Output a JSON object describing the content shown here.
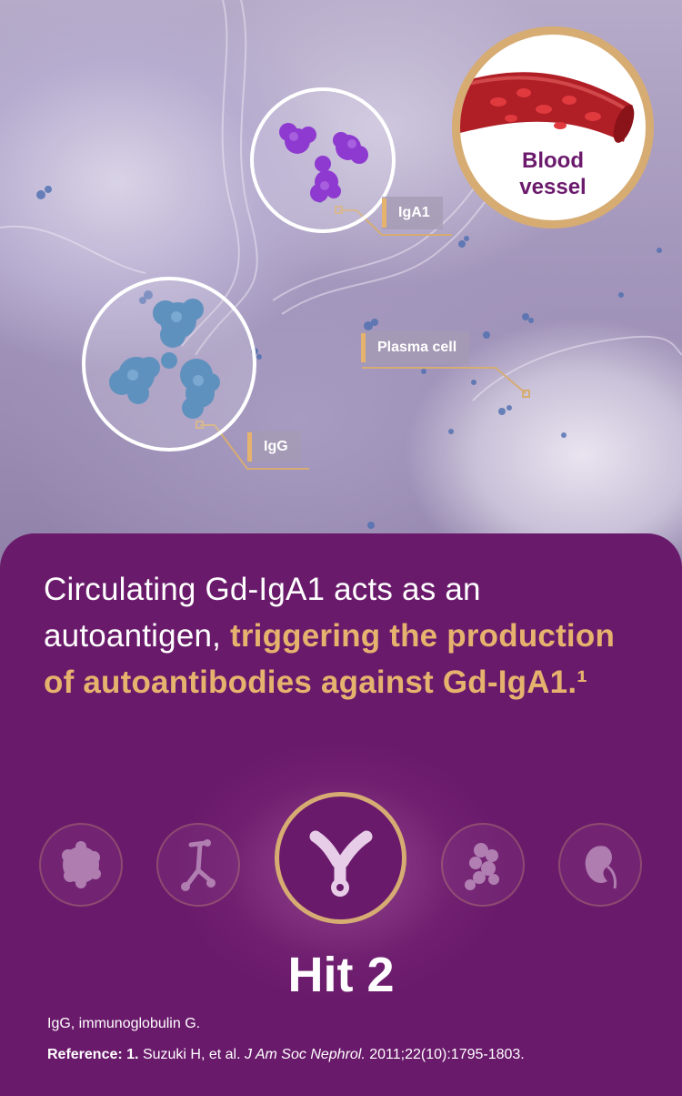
{
  "scene": {
    "blood_vessel_label_line1": "Blood",
    "blood_vessel_label_line2": "vessel",
    "iga1_label": "IgA1",
    "plasma_cell_label": "Plasma cell",
    "igg_label": "IgG"
  },
  "panel": {
    "headline_plain": "Circulating Gd-IgA1 acts as an autoantigen, ",
    "headline_highlight": "triggering the production of autoantibodies against Gd-IgA1.¹",
    "hit_label": "Hit 2",
    "abbreviation": "IgG, immunoglobulin G.",
    "reference": {
      "label": "Reference: 1.",
      "authors": " Suzuki H, et al. ",
      "journal": "J Am Soc Nephrol.",
      "citation": " 2011;22(10):1795-1803."
    }
  },
  "colors": {
    "panel_purple": "#6a1a6b",
    "accent_gold": "#e6b36e",
    "ring_gold": "#d6ac73",
    "iga1_purple": "#8e3ad0",
    "igg_blue": "#5f91bf",
    "vessel_red": "#b01e26"
  },
  "icons": [
    "plasma-cell-icon",
    "glycan-chain-icon",
    "antibody-icon",
    "immune-complex-icon",
    "kidney-icon"
  ]
}
